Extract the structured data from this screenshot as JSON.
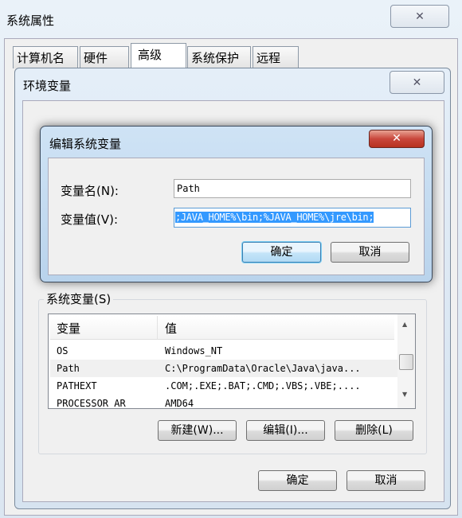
{
  "system_properties": {
    "title": "系统属性",
    "close_icon": "close-icon",
    "tabs": [
      {
        "label": "计算机名"
      },
      {
        "label": "硬件"
      },
      {
        "label": "高级",
        "selected": true
      },
      {
        "label": "系统保护"
      },
      {
        "label": "远程"
      }
    ]
  },
  "env_dialog": {
    "title": "环境变量",
    "system_vars": {
      "label": "系统变量(S)",
      "columns": [
        "变量",
        "值"
      ],
      "rows": [
        {
          "name": "OS",
          "value": "Windows_NT"
        },
        {
          "name": "Path",
          "value": "C:\\ProgramData\\Oracle\\Java\\java...",
          "selected": true
        },
        {
          "name": "PATHEXT",
          "value": ".COM;.EXE;.BAT;.CMD;.VBS;.VBE;...."
        },
        {
          "name": "PROCESSOR_AR",
          "value": "AMD64"
        }
      ],
      "new_label": "新建(W)...",
      "edit_label": "编辑(I)...",
      "delete_label": "删除(L)"
    },
    "ok_label": "确定",
    "cancel_label": "取消"
  },
  "edit_dialog": {
    "title": "编辑系统变量",
    "close_color": "#c9473c",
    "name_label": "变量名(N):",
    "name_value": "Path",
    "value_label": "变量值(V):",
    "value_value": ";JAVA_HOME%\\bin;%JAVA_HOME%\\jre\\bin;",
    "selection_color": "#3399ff",
    "ok_label": "确定",
    "cancel_label": "取消"
  }
}
